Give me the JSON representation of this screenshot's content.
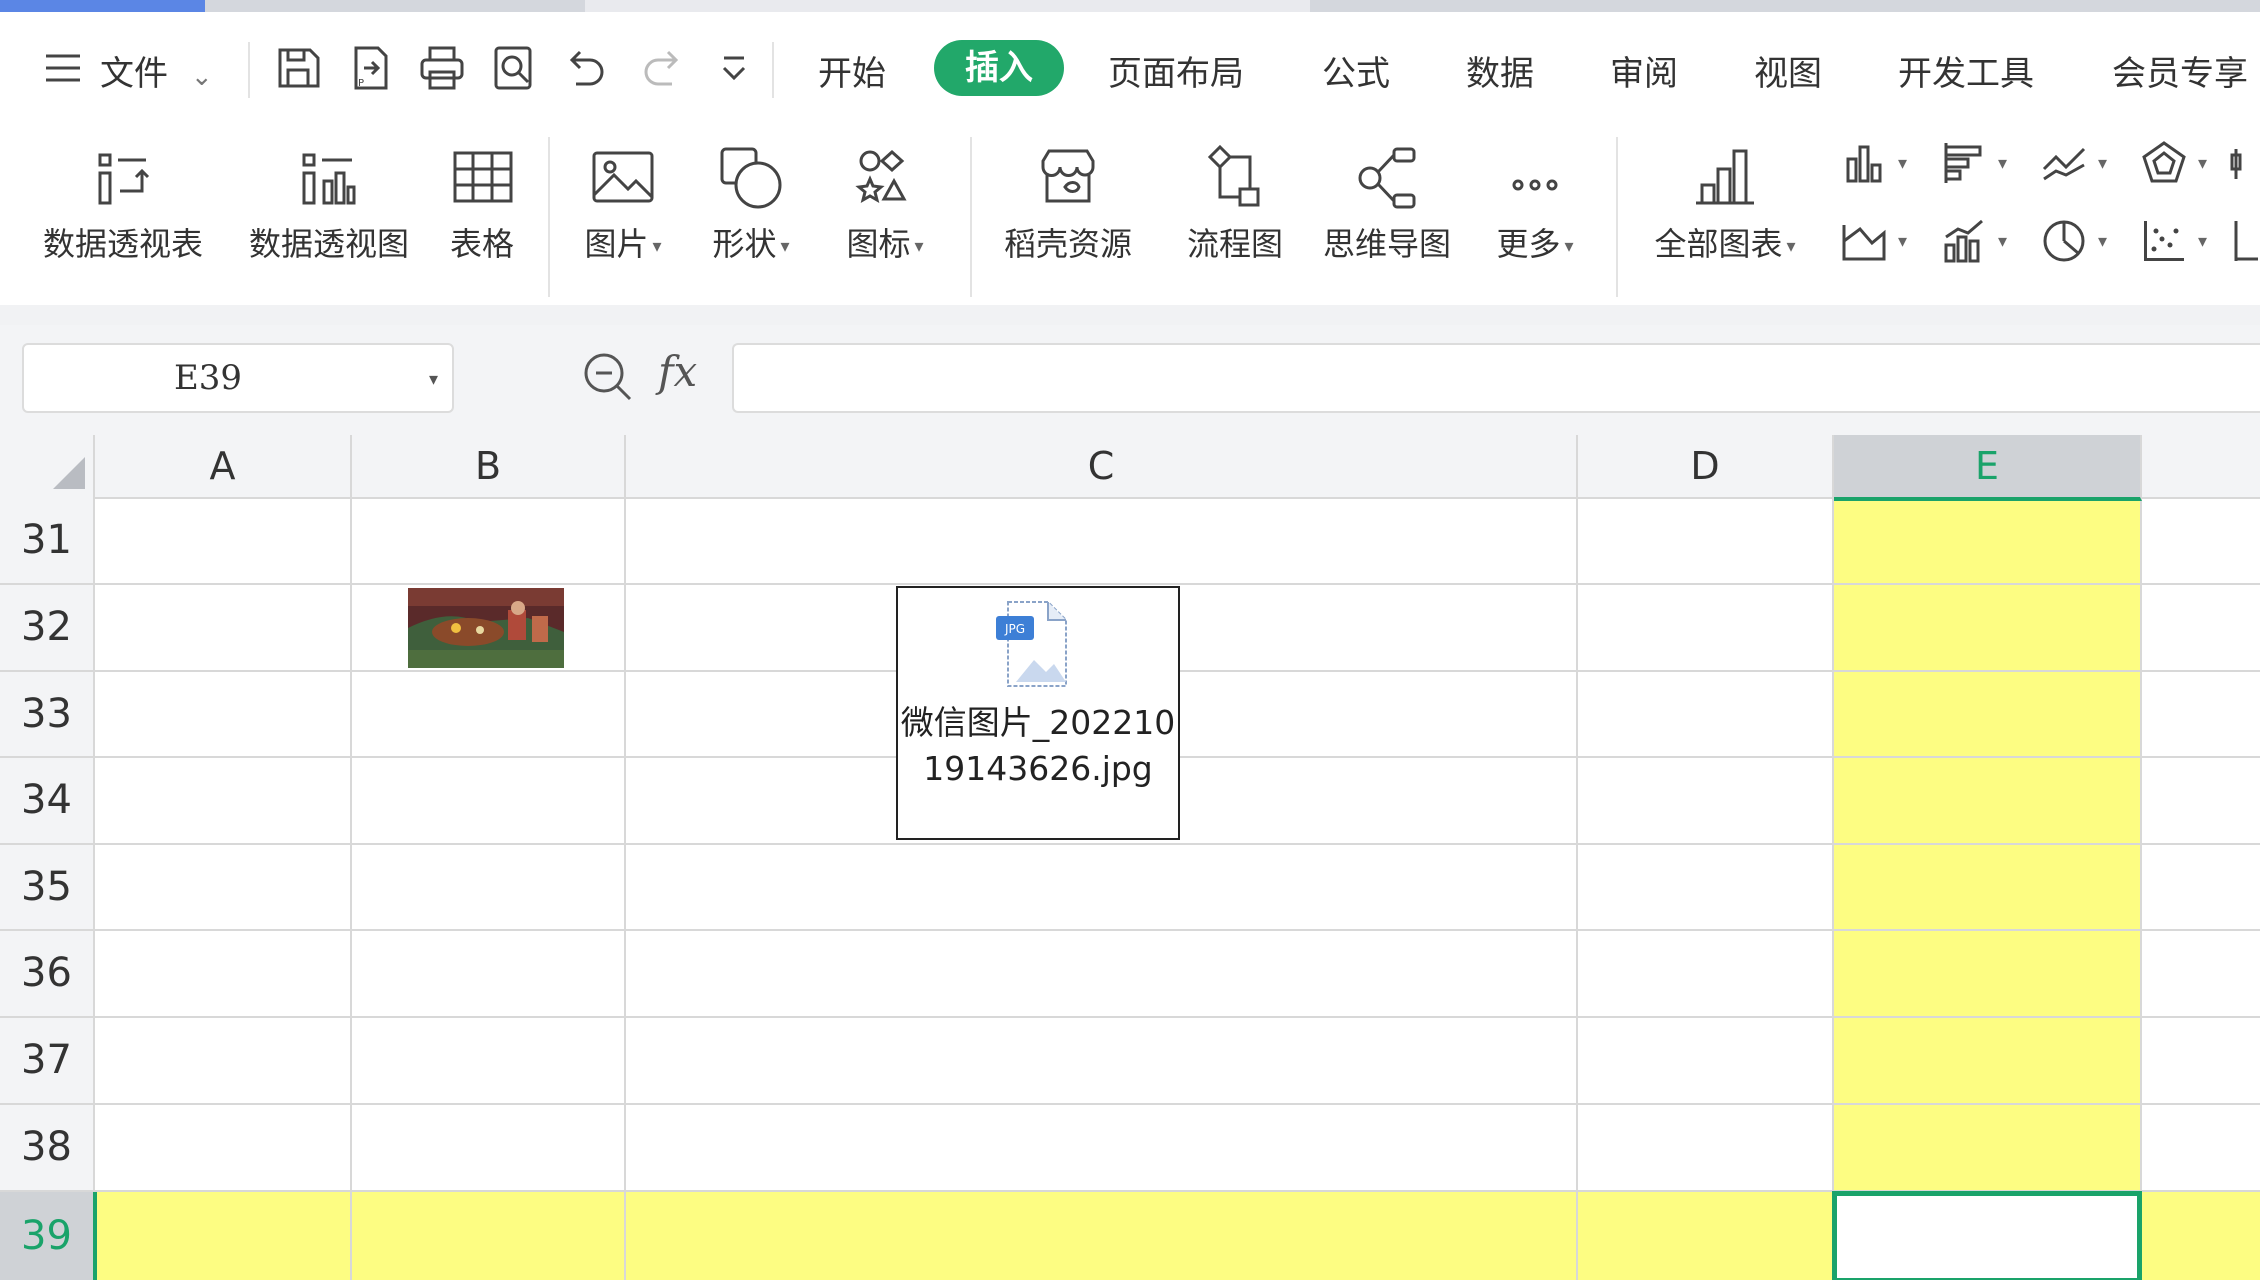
{
  "menu": {
    "menu_icon": "hamburger-menu-icon",
    "file_label": "文件",
    "tabs": [
      "开始",
      "插入",
      "页面布局",
      "公式",
      "数据",
      "审阅",
      "视图",
      "开发工具",
      "会员专享"
    ],
    "active_tab": "插入",
    "quick_access_icons": [
      "save-icon",
      "export-icon",
      "print-icon",
      "print-preview-icon",
      "undo-icon",
      "redo-icon",
      "customize-toolbar-icon"
    ]
  },
  "ribbon": {
    "buttons": [
      {
        "label": "数据透视表",
        "icon": "pivot-table-icon"
      },
      {
        "label": "数据透视图",
        "icon": "pivot-chart-icon"
      },
      {
        "label": "表格",
        "icon": "table-icon"
      },
      {
        "label": "图片",
        "icon": "picture-icon",
        "dropdown": true
      },
      {
        "label": "形状",
        "icon": "shape-icon",
        "dropdown": true
      },
      {
        "label": "图标",
        "icon": "icon-library-icon",
        "dropdown": true
      },
      {
        "label": "稻壳资源",
        "icon": "docer-resources-icon"
      },
      {
        "label": "流程图",
        "icon": "flowchart-icon"
      },
      {
        "label": "思维导图",
        "icon": "mind-map-icon"
      },
      {
        "label": "更多",
        "icon": "more-icon",
        "dropdown": true
      },
      {
        "label": "全部图表",
        "icon": "all-charts-icon",
        "dropdown": true
      }
    ],
    "small_chart_icons": [
      "column-chart-icon",
      "bar-chart-icon",
      "line-chart-icon",
      "radar-chart-icon",
      "area-chart-icon",
      "combo-chart-icon",
      "pie-chart-icon",
      "scatter-chart-icon"
    ]
  },
  "formula_bar": {
    "name_box": "E39",
    "zoom_icon": "zoom-formula-icon",
    "fx_label": "fx",
    "formula": ""
  },
  "sheet": {
    "columns": [
      "A",
      "B",
      "C",
      "D",
      "E"
    ],
    "selected_column": "E",
    "rows": [
      "31",
      "32",
      "33",
      "34",
      "35",
      "36",
      "37",
      "38",
      "39"
    ],
    "selected_row": "39",
    "active_cell": "E39",
    "highlight_color": "#fdfd82",
    "accent_color": "#1aa36a",
    "embedded_picture_cell": "B32",
    "attachment": {
      "file_type_badge": "JPG",
      "filename_line1": "微信图片_202210",
      "filename_line2": "19143626.jpg"
    }
  }
}
